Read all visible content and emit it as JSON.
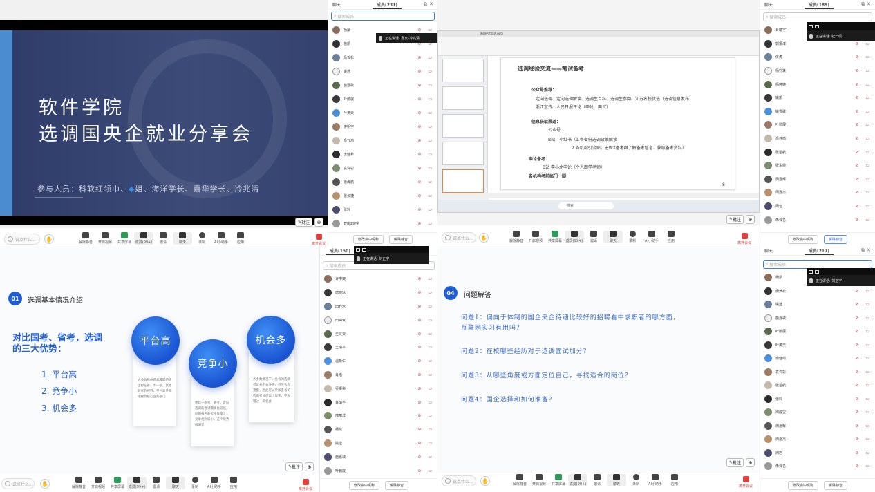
{
  "q1": {
    "slide": {
      "title_line1": "软件学院",
      "title_line2": "选调国央企就业分享会",
      "participants": "参与人员：科软红领巾、",
      "participants_rest": "姐、海洋学长、嘉华学长、冷兆清"
    },
    "panel": {
      "tab_chat": "聊天",
      "tab_members": "成员(231)",
      "search_placeholder": "搜索成员",
      "members": [
        "杨蒙",
        "施凯",
        "杨贺松",
        "姚选",
        "施嘉歌",
        "叶鹏展",
        "叶英天",
        "伊明宇",
        "俞飞鸿",
        "庞佳希",
        "袁许彰",
        "张海航",
        "张云捷",
        "张玲",
        "智能2班宇"
      ],
      "foot_btn1": "修改会中昵称",
      "foot_btn2": "解除静音"
    },
    "speaking": "正在讲话: 嘉宾-冷兆清",
    "annotate": "批注"
  },
  "toolbar": {
    "say": "说点什么...",
    "buttons": [
      "解除静音",
      "开启视频",
      "共享屏幕",
      "成员(99+)",
      "邀请",
      "聊天",
      "录制",
      "AI小助手",
      "应用"
    ],
    "leave": "离开会议"
  },
  "q2": {
    "window_tab": "选调经验交流.pptx",
    "doc_title": "选调经验交流——笔试备考",
    "sections": [
      {
        "head": "公众号推荐：",
        "lines": [
          "定向选调、定向选调解读、选调生百科、选调生参阅、江苏名校优选（选调信息发布）",
          "浙江宣传、人民日报评论（申论、面试）"
        ]
      },
      {
        "head": "信息获取渠道：",
        "lines": [
          "公众号",
          "B站、小红书（1.各省份选调政策解读",
          "2.各机构引流贴，进WX备考群了解备考信息、获取备考资料）"
        ]
      },
      {
        "head": "申论备考：",
        "lines": [
          "B站 李小北申论（个人跟学老师）"
        ]
      },
      {
        "head": "各机构考前临门一脚",
        "lines": []
      }
    ],
    "page_num": "8",
    "taskbar_search": "搜索",
    "panel": {
      "tab_chat": "聊天",
      "tab_members": "成员(189)",
      "search_placeholder": "搜索成员",
      "members": [
        "肖瑞宇",
        "郭振洋",
        "侯涛",
        "杨钧轶",
        "杨婷婷",
        "姚凯",
        "姚雪歌",
        "叶鹏展",
        "俞佳鸣",
        "张蜀航",
        "张东荣",
        "周嘉辉",
        "周嘉杰",
        "周岩",
        "朱译名"
      ],
      "foot_btn1": "修改会中昵称",
      "foot_btn2": "解除静音"
    },
    "speaking": "正在讲话: 牡一帆",
    "annotate": "批注"
  },
  "q3": {
    "section_num": "01",
    "section_title": "选调基本情况介绍",
    "left_title_1": "对比国考、省考，选调",
    "left_title_2": "的三大优势：",
    "items": [
      "1. 平台高",
      "2. 竞争小",
      "3. 机会多"
    ],
    "circles": [
      "平台高",
      "竞争小",
      "机会多"
    ],
    "card_texts": [
      "大多数省份选调履职的岗位都在省、市一级，具备较宽的视野，平台高且能接触到核心业务部门",
      "相比于国考、省考，定向选调的考试需要比较低，同期报名的考生数量少，竞争相对较小，这个优势很明显",
      "大多数情况下，各省的选调考试并不会冲突，甚至会有重叠，因此可以参加多省的选调考试提高上岸率，不会错过一次机会"
    ],
    "panel": {
      "tab_members": "成员(150)",
      "search_placeholder": "搜索成员",
      "members": [
        "许申爽",
        "唐晓冰",
        "田乔木",
        "田婷欢",
        "王昊天",
        "王瑞平",
        "温新仁",
        "肖浩",
        "吴振科",
        "肖瑞宇",
        "邢丽洋",
        "杨凯",
        "姚选",
        "施嘉歌",
        "叶鹏展"
      ],
      "foot_btn1": "修改会中昵称",
      "foot_btn2": "解除静音"
    },
    "speaking": "正在讲话: 刘正宇",
    "annotate": "批注"
  },
  "q4": {
    "section_num": "04",
    "section_title": "问题解答",
    "questions": [
      "问题1：偏向于体制的国企央企待遇比较好的招聘看中求职者的哪方面，",
      "互联网实习有用吗？",
      "问题2：在校哪些经历对于选调面试加分？",
      "问题3：从哪些角度或方面定位自己，寻找适合的岗位？",
      "问题4：国企选择和如何准备？"
    ],
    "panel": {
      "tab_chat": "聊天",
      "tab_members": "成员(217)",
      "search_placeholder": "搜索成员",
      "members": [
        "杨凯",
        "杨贺松",
        "姚选",
        "施嘉歌",
        "叶鹏展",
        "叶英天",
        "俞佳鸣",
        "袁许彰",
        "张蜀航",
        "张玲",
        "周成宝",
        "周嘉辉",
        "周嘉杰",
        "周岩",
        "朱译名"
      ],
      "foot_btn1": "修改会中昵称",
      "foot_btn2": "解除静音"
    },
    "speaking": "正在讲话: 刘正宇",
    "annotate": "批注"
  },
  "colors": {
    "accent": "#2a63cf",
    "leave": "#e0403b",
    "slide_bg": "#2f3f6f"
  }
}
